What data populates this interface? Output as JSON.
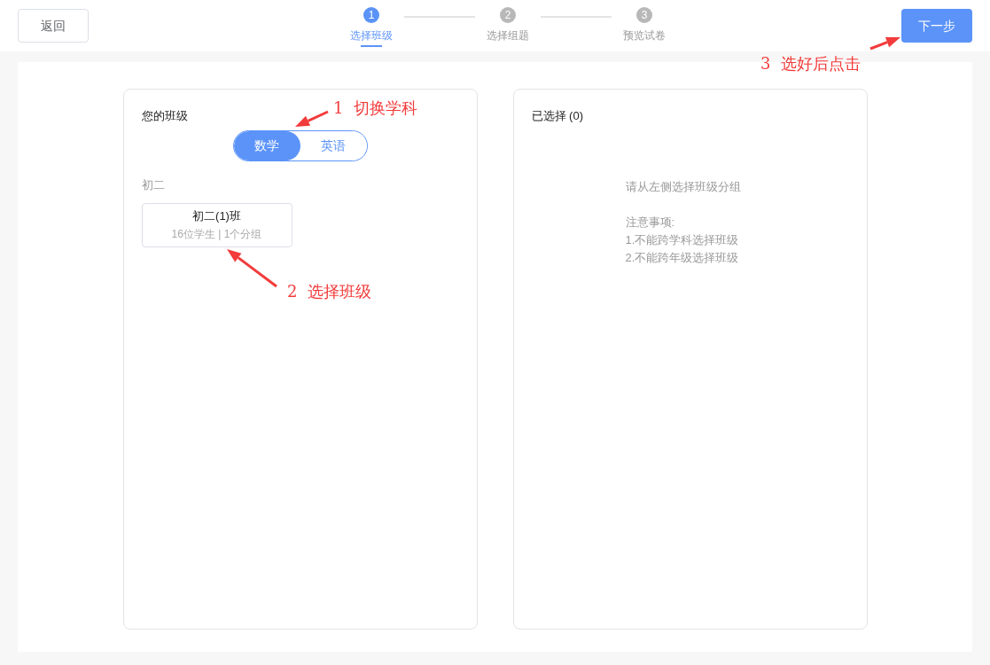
{
  "header": {
    "back_button": "返回",
    "next_button": "下一步",
    "steps": [
      {
        "number": "1",
        "label": "选择班级",
        "selected": true
      },
      {
        "number": "2",
        "label": "选择组题",
        "selected": false
      },
      {
        "number": "3",
        "label": "预览试卷",
        "selected": false
      }
    ]
  },
  "class_panel": {
    "title": "您的班级",
    "subjects": [
      {
        "label": "数学",
        "selected": true
      },
      {
        "label": "英语",
        "selected": false
      }
    ],
    "grade": "初二",
    "classes": [
      {
        "name": "初二(1)班",
        "info": "16位学生 | 1个分组"
      }
    ]
  },
  "selected_panel": {
    "title": "已选择 (0)",
    "hint": "请从左侧选择班级分组",
    "notes_title": "注意事项:",
    "notes": [
      "1.不能跨学科选择班级",
      "2.不能跨年级选择班级"
    ]
  },
  "annotations": [
    {
      "text": "1  切换学科"
    },
    {
      "text": "2  选择班级"
    },
    {
      "text": "3  选好后点击"
    }
  ]
}
